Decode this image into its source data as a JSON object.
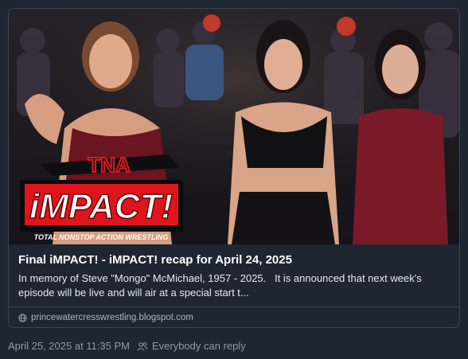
{
  "link_card": {
    "image": {
      "logo_brand": "TNA",
      "logo_title": "iMPACT!",
      "logo_tagline": "TOTAL NONSTOP ACTION WRESTLING"
    },
    "title": "Final iMPACT! - iMPACT! recap for April 24, 2025",
    "description": "In memory of Steve \"Mongo\" McMichael, 1957 - 2025.   It is announced that next week's episode will be live and will air at a special start t...",
    "source": "princewatercresswrestling.blogspot.com",
    "source_icon": "globe-icon"
  },
  "post_meta": {
    "timestamp": "April 25, 2025 at 11:35 PM",
    "reply_setting": "Everybody can reply",
    "reply_icon": "people-icon"
  },
  "colors": {
    "background": "#1e2631",
    "border": "#3a4654",
    "muted_text": "#8d9aa8",
    "logo_red": "#e0141c"
  }
}
